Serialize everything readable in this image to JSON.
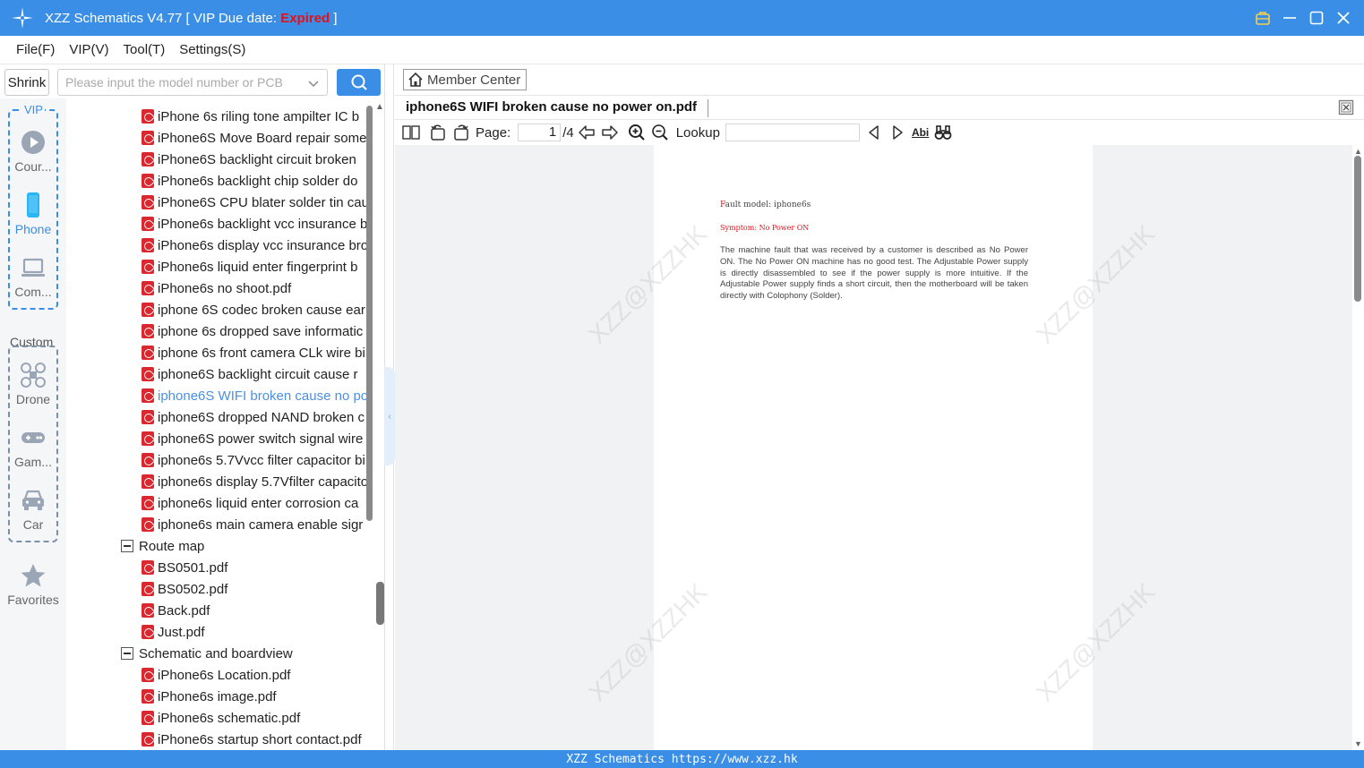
{
  "window": {
    "title_prefix": "XZZ Schematics V4.77 [ VIP Due date: ",
    "title_status": "Expired",
    "title_suffix": " ]"
  },
  "menu": [
    "File(F)",
    "VIP(V)",
    "Tool(T)",
    "Settings(S)"
  ],
  "search": {
    "shrink_label": "Shrink",
    "placeholder": "Please input the model number or PCB"
  },
  "categories": {
    "vip_label": "VIP",
    "custom_label": "Custom",
    "vip_items": [
      {
        "label": "Cour...",
        "icon": "play-icon"
      },
      {
        "label": "Phone",
        "icon": "phone-icon"
      },
      {
        "label": "Com...",
        "icon": "laptop-icon"
      }
    ],
    "custom_items": [
      {
        "label": "Drone",
        "icon": "drone-icon"
      },
      {
        "label": "Gam...",
        "icon": "gamepad-icon"
      },
      {
        "label": "Car",
        "icon": "car-icon"
      }
    ],
    "favorites_label": "Favorites"
  },
  "tree": {
    "files_top": [
      "iPhone 6s riling tone ampilter IC b",
      "iPhone6S Move Board repair some",
      "iPhone6S backlight circuit broken",
      "iPhone6s  backlight chip solder do",
      "iPhone6S CPU blater solder tin cau",
      "iPhone6s backlight vcc insurance b",
      "iPhone6s display vcc insurance bro",
      "iPhone6s liquid enter fingerprint b",
      "iPhone6s no shoot.pdf",
      "iphone 6S codec broken cause ear",
      "iphone 6s dropped save informatic",
      "iphone 6s front camera CLk wire bi",
      "iphone6S  backlight circuit cause r",
      "iphone6S WIFI broken cause no po",
      "iphone6S dropped NAND broken c",
      "iphone6S power switch signal wire",
      "iphone6s 5.7Vvcc filter capacitor bi",
      "iphone6s display 5.7Vfilter capacito",
      "iphone6s liquid enter corrosion ca",
      "iphone6s main camera enable sigr"
    ],
    "selected_index": 13,
    "folder_route": "Route map",
    "files_route": [
      "BS0501.pdf",
      "BS0502.pdf",
      "Back.pdf",
      "Just.pdf"
    ],
    "folder_schematic": "Schematic and boardview",
    "files_schematic": [
      "iPhone6s Location.pdf",
      "iPhone6s image.pdf",
      "iPhone6s schematic.pdf",
      "iPhone6s startup short contact.pdf"
    ]
  },
  "viewer": {
    "member_center": "Member Center",
    "tab_title": "iphone6S WIFI broken cause no power on.pdf",
    "page_label": "Page:",
    "page_current": "1",
    "page_total": "/4",
    "lookup_label": "Lookup",
    "abi_label": "Abi",
    "doc": {
      "fault_model_first": "F",
      "fault_model_rest": "ault model: iphone6s",
      "symptom": "Symptom: No Power ON",
      "body": "The machine fault that was received by a customer is described as No Power ON. The No Power ON machine has no good test. The Adjustable Power supply is directly disassembled to see if the power supply is more intuitive. If the Adjustable Power supply finds a short circuit, then the motherboard will be taken directly with Colophony (Solder)."
    },
    "watermark": "XZZ@XZZHK"
  },
  "status": "XZZ Schematics https://www.xzz.hk",
  "colors": {
    "accent": "#3a8ee6",
    "expired": "#e0131d",
    "pdf_red": "#d9282f",
    "selected": "#4a90e2"
  }
}
